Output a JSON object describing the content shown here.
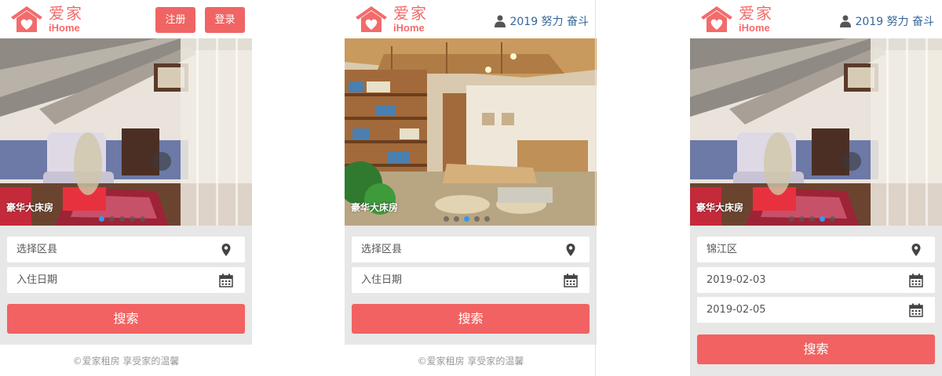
{
  "brand": {
    "name_cn": "爱家",
    "name_en": "iHome",
    "color": "#f36b6b"
  },
  "auth": {
    "register_label": "注册",
    "login_label": "登录"
  },
  "user": {
    "name": "2019 努力 奋斗",
    "icon": "user-icon"
  },
  "slides": [
    {
      "caption": "豪华大床房",
      "scene": "attic-bedroom",
      "active_dot": 0
    },
    {
      "caption": "豪华大床房",
      "scene": "wood-library-lounge",
      "active_dot": 2
    },
    {
      "caption": "豪华大床房",
      "scene": "attic-bedroom",
      "active_dot": 3
    }
  ],
  "slide_count": 5,
  "search_form": {
    "area_placeholder": "选择区县",
    "checkin_placeholder": "入住日期",
    "search_label": "搜索"
  },
  "filled_form": {
    "area_value": "锦江区",
    "start_date": "2019-02-03",
    "end_date": "2019-02-05",
    "search_label": "搜索"
  },
  "footer": {
    "text": "©爱家租房   享受家的温馨"
  },
  "colors": {
    "accent": "#f06464",
    "user_link": "#336699",
    "dot_active": "#3399ee",
    "form_bg": "#e7e7e7"
  }
}
